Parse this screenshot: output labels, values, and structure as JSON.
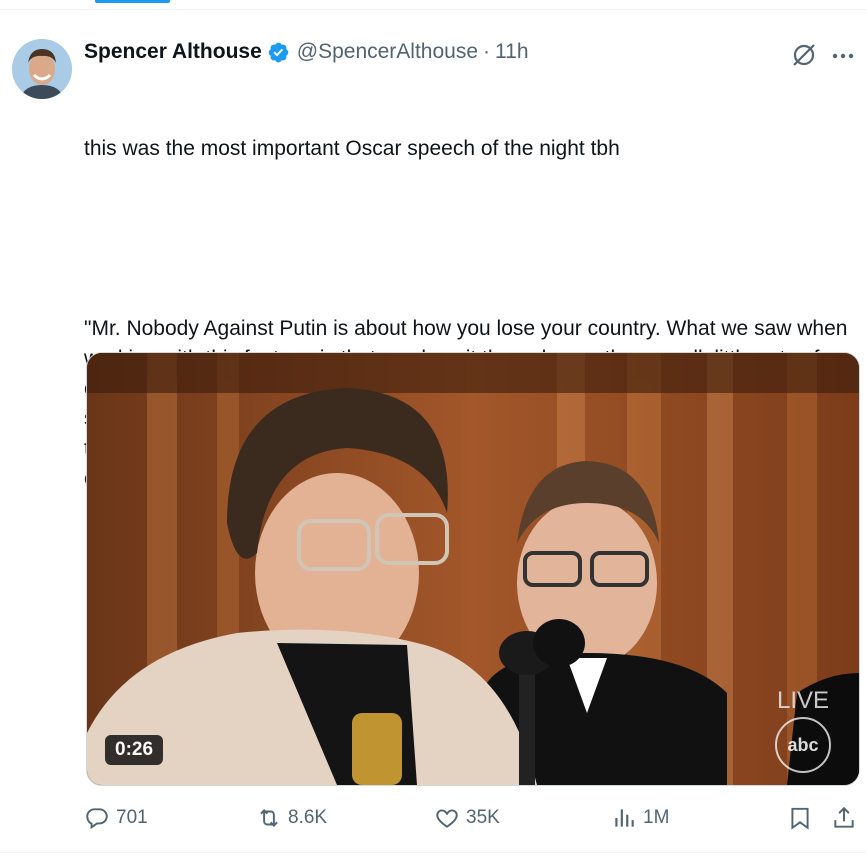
{
  "tweet": {
    "author": {
      "name": "Spencer Althouse",
      "handle": "@SpencerAlthouse",
      "separator": "·",
      "time": "11h",
      "verified": true
    },
    "text_intro": "this was the most important Oscar speech of the night tbh",
    "text_quote": "\"Mr. Nobody Against Putin is about how you lose your country. What we saw when working with this footage is that you lose it through countless small, little acts of complicity: when we act complicit when a government murders people on the streets of our major cities, when we don't say anything when oligarchs take over the media and control how we can produce it and consume it, we all face a moral choice. But luckily even a nobody is more powerful than you think.\"",
    "media": {
      "duration": "0:26",
      "live_label": "LIVE",
      "network_logo": "abc"
    },
    "actions": {
      "replies": "701",
      "reposts": "8.6K",
      "likes": "35K",
      "views": "1M"
    }
  },
  "icons": {
    "verified": "verified-badge-icon",
    "grok": "grok-icon",
    "more": "more-options-icon",
    "reply": "reply-icon",
    "repost": "repost-icon",
    "like": "heart-icon",
    "views": "views-bar-chart-icon",
    "bookmark": "bookmark-icon",
    "share": "share-icon"
  },
  "colors": {
    "accent": "#1d9bf0",
    "text": "#0f1419",
    "muted": "#536471"
  }
}
